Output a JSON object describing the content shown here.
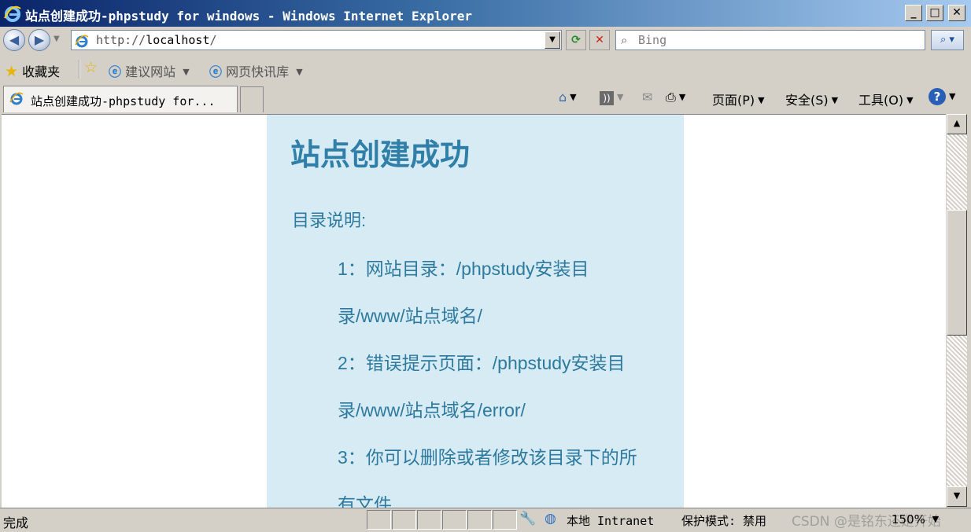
{
  "window": {
    "title": "站点创建成功-phpstudy for windows - Windows Internet Explorer",
    "controls": {
      "minimize": "_",
      "maximize": "□",
      "close": "✕"
    }
  },
  "address": {
    "url_prefix": "http://",
    "url_host": "localhost",
    "url_suffix": "/",
    "search_placeholder": "Bing"
  },
  "favorites": {
    "label": "收藏夹",
    "items": [
      {
        "label": "建议网站"
      },
      {
        "label": "网页快讯库"
      }
    ]
  },
  "tabs": {
    "active_label": "站点创建成功-phpstudy for..."
  },
  "commandbar": {
    "page": "页面(P)",
    "safety": "安全(S)",
    "tools": "工具(O)",
    "help": "?"
  },
  "page": {
    "heading": "站点创建成功",
    "subheading": "目录说明:",
    "lines": [
      "1：网站目录：/phpstudy安装目",
      "录/www/站点域名/",
      "2：错误提示页面：/phpstudy安装目",
      "录/www/站点域名/error/",
      "3：你可以删除或者修改该目录下的所",
      "有文件"
    ]
  },
  "status": {
    "text": "完成",
    "zone": "本地 Intranet",
    "protected_mode": "保护模式: 禁用",
    "zoom": "150%",
    "watermark": "CSDN @是铭东还是开始"
  },
  "colors": {
    "panel_bg": "#d7ebf5",
    "panel_text": "#2d7a9e"
  }
}
